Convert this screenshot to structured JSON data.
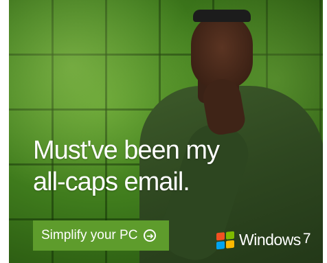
{
  "ad": {
    "headline_line1": "Must've been my",
    "headline_line2": "all-caps email.",
    "cta_label": "Simplify your PC",
    "cta_icon": "arrow-right-circle-icon",
    "brand_name": "Windows",
    "brand_version": "7",
    "logo_icon": "windows-flag-icon"
  },
  "colors": {
    "cta_background": "#5e9c2c",
    "text": "#ffffff",
    "flag_red": "#f25022",
    "flag_green": "#7fba00",
    "flag_blue": "#00a4ef",
    "flag_yellow": "#ffb900"
  }
}
